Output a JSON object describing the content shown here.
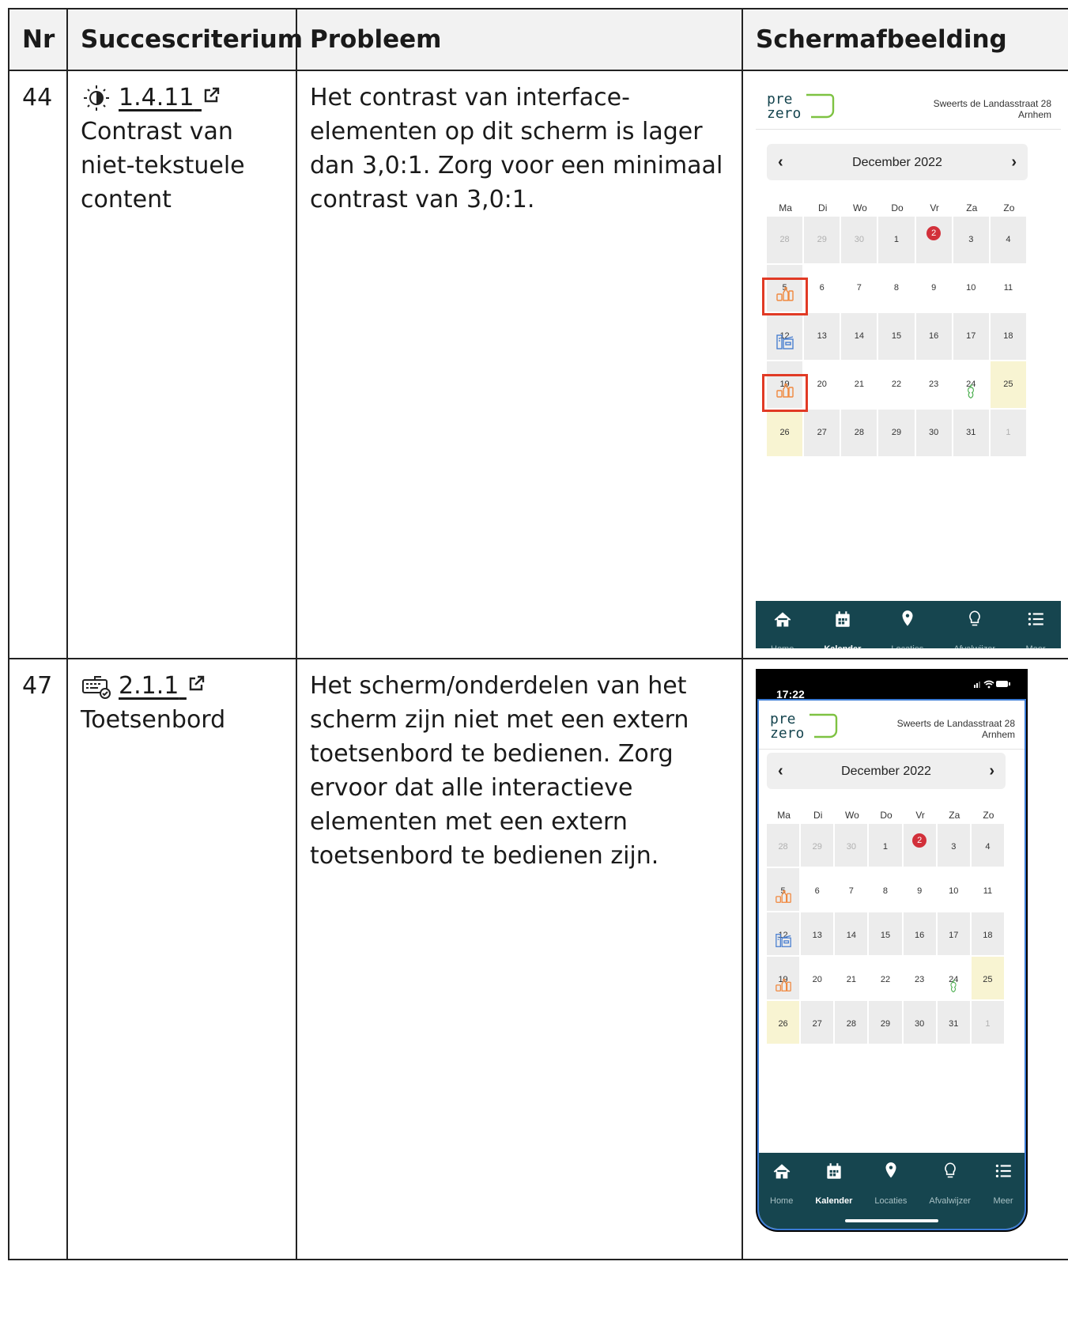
{
  "table": {
    "headers": [
      "Nr",
      "Succescriterium",
      "Probleem",
      "Schermafbeelding"
    ],
    "rows": [
      {
        "nr": "44",
        "criterion_code": "1.4.11",
        "criterion_name": "Contrast van niet-tekstuele content",
        "problem": "Het contrast van interface-elementen op dit scherm is lager dan 3,0:1. Zorg voor een minimaal contrast van 3,0:1.",
        "criterion_icon": "contrast-icon"
      },
      {
        "nr": "47",
        "criterion_code": "2.1.1",
        "criterion_name": "Toetsenbord",
        "problem": "Het scherm/onderdelen van het scherm zijn niet met een extern toetsenbord te bedienen. Zorg ervoor dat alle interactieve elementen met een extern toetsenbord te bedienen zijn.",
        "criterion_icon": "keyboard-icon"
      }
    ]
  },
  "app": {
    "address_line1": "Sweerts de Landasstraat 28",
    "address_line2": "Arnhem",
    "month": "December 2022",
    "prev": "‹",
    "next": "›",
    "weekdays": [
      "Ma",
      "Di",
      "Wo",
      "Do",
      "Vr",
      "Za",
      "Zo"
    ],
    "weeks": [
      [
        "28",
        "29",
        "30",
        "1",
        "2",
        "3",
        "4"
      ],
      [
        "5",
        "6",
        "7",
        "8",
        "9",
        "10",
        "11"
      ],
      [
        "12",
        "13",
        "14",
        "15",
        "16",
        "17",
        "18"
      ],
      [
        "19",
        "20",
        "21",
        "22",
        "23",
        "24",
        "25"
      ],
      [
        "26",
        "27",
        "28",
        "29",
        "30",
        "31",
        "1"
      ]
    ],
    "status_time": "17:22",
    "tabs": [
      "Home",
      "Kalender",
      "Locaties",
      "Afvalwijzer",
      "Meer"
    ],
    "active_tab": "Kalender",
    "colors": {
      "tabbar": "#16454f",
      "logo_green": "#7ec242",
      "highlight": "#e13a25",
      "plastic": "#f0883e",
      "paper": "#4a7fd0",
      "organic": "#4caf50"
    }
  }
}
